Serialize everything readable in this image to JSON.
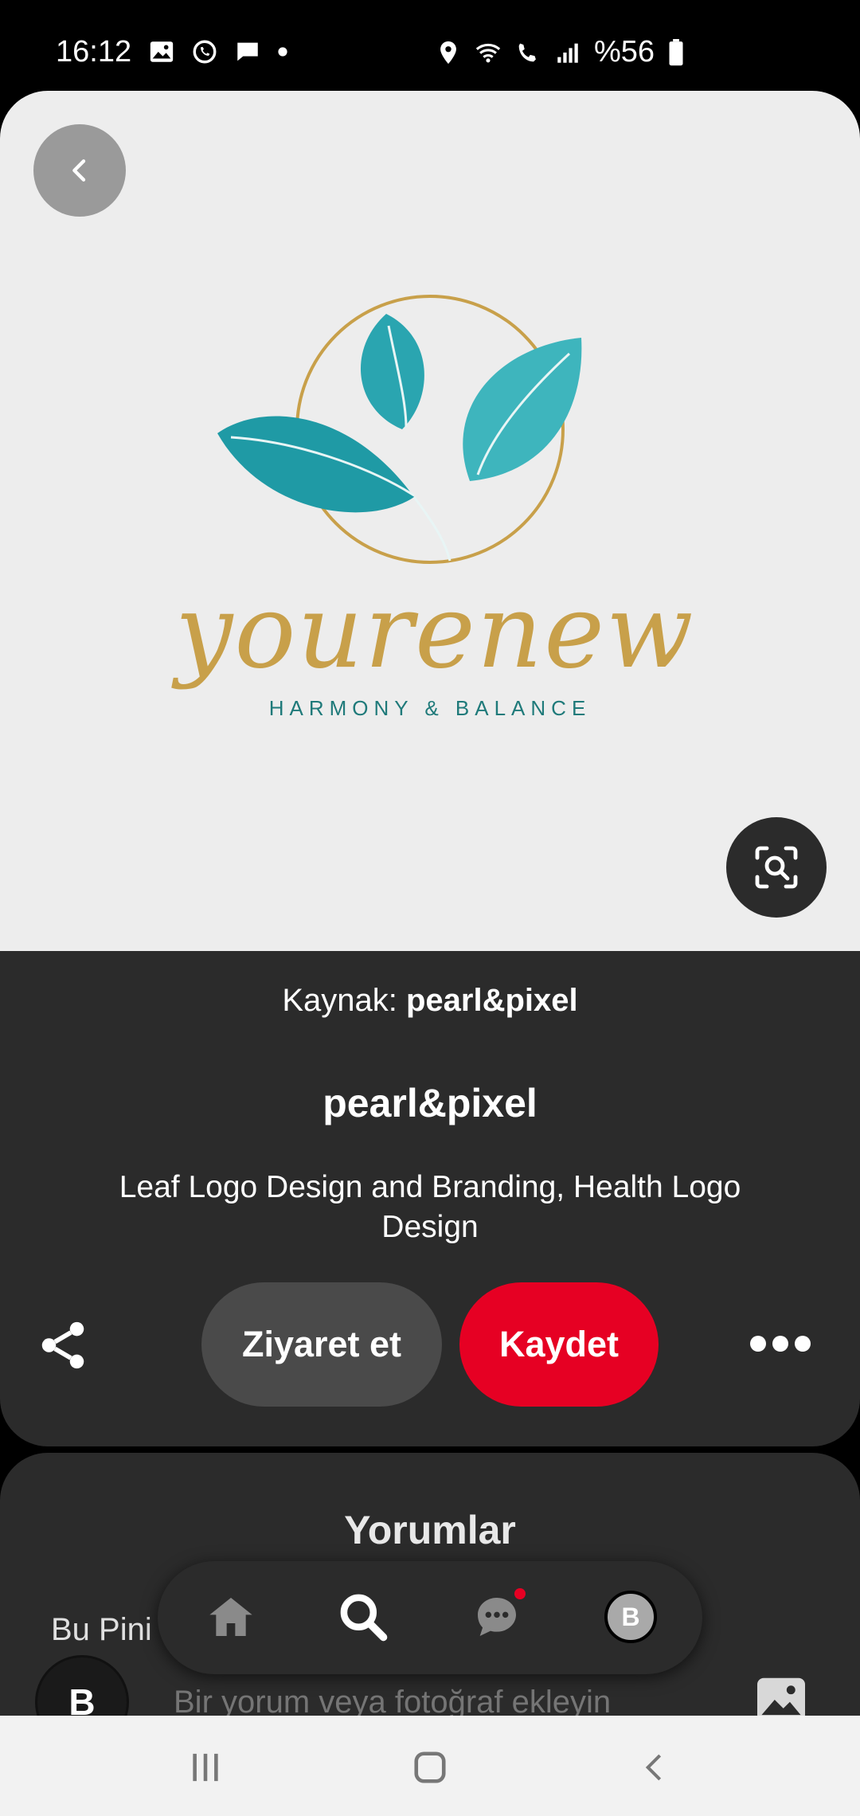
{
  "status_bar": {
    "time": "16:12",
    "battery": "%56",
    "left_icons": [
      "gallery-icon",
      "whatsapp-icon",
      "message-icon",
      "dot-icon"
    ],
    "right_icons": [
      "location-icon",
      "wifi-icon",
      "wifi-call-icon",
      "signal-icon",
      "battery-icon"
    ]
  },
  "pin_image": {
    "brand_name": "yourenew",
    "brand_tagline": "HARMONY & BALANCE",
    "colors": {
      "teal": "#1f9aa5",
      "gold": "#c8a04a",
      "background": "#ededed"
    }
  },
  "pin_info": {
    "source_prefix": "Kaynak: ",
    "source_name": "pearl&pixel",
    "author": "pearl&pixel",
    "description": "Leaf Logo Design and Branding, Health Logo Design",
    "visit_label": "Ziyaret et",
    "save_label": "Kaydet"
  },
  "comments": {
    "title": "Yorumlar",
    "subtitle": "Bu Pini",
    "avatar_initial": "B",
    "input_placeholder": "Bir yorum veya fotoğraf ekleyin"
  },
  "bottom_nav": {
    "items": [
      "home-icon",
      "search-icon",
      "messages-icon",
      "profile-avatar"
    ],
    "profile_initial": "B",
    "active": "search"
  },
  "accent_colors": {
    "save": "#e60023",
    "panel": "#2b2b2b"
  }
}
